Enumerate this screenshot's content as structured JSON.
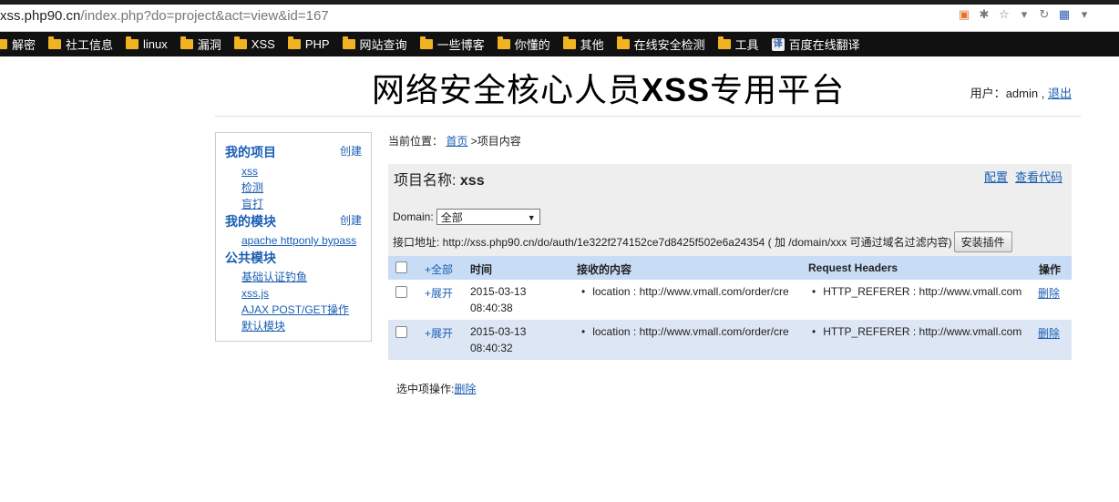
{
  "browser": {
    "url_host": "xss.php90.cn",
    "url_path": "/index.php?do=project&act=view&id=167",
    "bookmarks": [
      "解密",
      "社工信息",
      "linux",
      "漏洞",
      "XSS",
      "PHP",
      "网站查询",
      "一些博客",
      "你懂的",
      "其他",
      "在线安全检测",
      "工具",
      "百度在线翻译"
    ]
  },
  "header": {
    "title_prefix": "网络安全核心人员",
    "title_bold": "XSS",
    "title_suffix": "专用平台",
    "user_label": "用户：",
    "user_name": "admin",
    "separator": ",",
    "logout": "退出"
  },
  "sidebar": {
    "my_projects": {
      "title": "我的项目",
      "create": "创建",
      "items": [
        "xss",
        "检测",
        "盲打"
      ]
    },
    "my_modules": {
      "title": "我的模块",
      "create": "创建",
      "items": [
        "apache httponly bypass"
      ]
    },
    "public_modules": {
      "title": "公共模块",
      "items": [
        "基础认证钓鱼",
        "xss.js",
        "AJAX POST/GET操作",
        "默认模块"
      ]
    }
  },
  "breadcrumb": {
    "label": "当前位置：",
    "home": "首页",
    "sep": ">",
    "current": "项目内容"
  },
  "project": {
    "name_label": "项目名称:",
    "name": "xss",
    "config_link": "配置",
    "view_code_link": "查看代码",
    "domain_label": "Domain:",
    "domain_selected": "全部",
    "api_text": "接口地址: http://xss.php90.cn/do/auth/1e322f274152ce7d8425f502e6a24354 ( 加 /domain/xxx 可通过域名过滤内容)",
    "install_plugin": "安装插件"
  },
  "table": {
    "headers": {
      "all": "+全部",
      "time": "时间",
      "content": "接收的内容",
      "request_headers": "Request Headers",
      "action": "操作"
    },
    "rows": [
      {
        "expand": "+展开",
        "date": "2015-03-13",
        "time": "08:40:38",
        "content": "location : http://www.vmall.com/order/cre",
        "header": "HTTP_REFERER : http://www.vmall.com",
        "delete": "删除"
      },
      {
        "expand": "+展开",
        "date": "2015-03-13",
        "time": "08:40:32",
        "content": "location : http://www.vmall.com/order/cre",
        "header": "HTTP_REFERER : http://www.vmall.com",
        "delete": "删除"
      }
    ]
  },
  "footer": {
    "label": "选中项操作:",
    "delete": "删除"
  }
}
